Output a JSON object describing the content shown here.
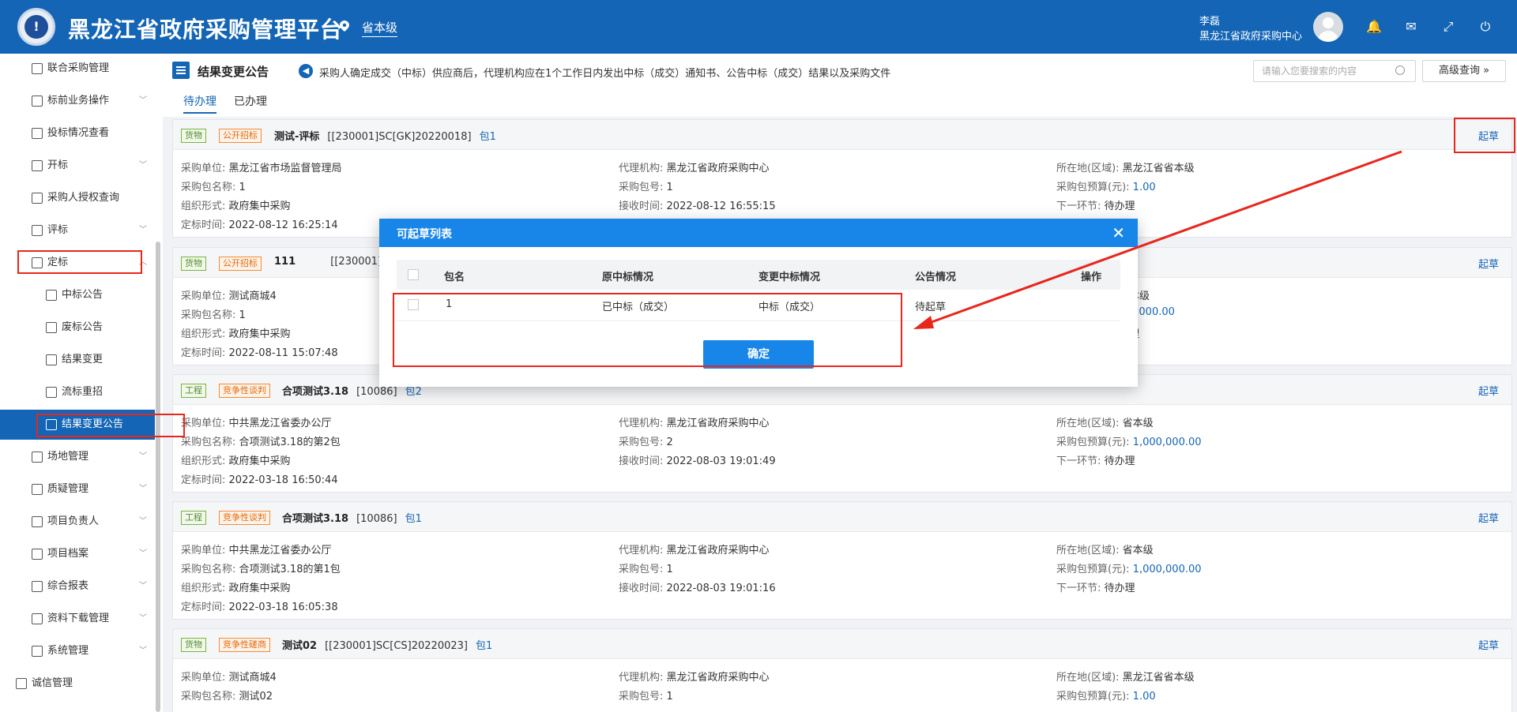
{
  "header": {
    "app_title": "黑龙江省政府采购管理平台",
    "region": "省本级",
    "user_name": "李磊",
    "user_org": "黑龙江省政府采购中心"
  },
  "sidebar": {
    "items": [
      {
        "label": "联合采购管理",
        "chevron": false
      },
      {
        "label": "标前业务操作",
        "chevron": true
      },
      {
        "label": "投标情况查看",
        "chevron": false
      },
      {
        "label": "开标",
        "chevron": true
      },
      {
        "label": "采购人授权查询",
        "chevron": false
      },
      {
        "label": "评标",
        "chevron": true
      },
      {
        "label": "定标",
        "chevron": true
      },
      {
        "label": "中标公告",
        "chevron": false
      },
      {
        "label": "废标公告",
        "chevron": false
      },
      {
        "label": "结果变更",
        "chevron": false
      },
      {
        "label": "流标重招",
        "chevron": false
      },
      {
        "label": "结果变更公告",
        "chevron": false
      },
      {
        "label": "场地管理",
        "chevron": true
      },
      {
        "label": "质疑管理",
        "chevron": true
      },
      {
        "label": "项目负责人",
        "chevron": true
      },
      {
        "label": "项目档案",
        "chevron": true
      },
      {
        "label": "综合报表",
        "chevron": true
      },
      {
        "label": "资料下载管理",
        "chevron": true
      },
      {
        "label": "系统管理",
        "chevron": true
      },
      {
        "label": "诚信管理",
        "chevron": false
      }
    ]
  },
  "page": {
    "title": "结果变更公告",
    "notice": "采购人确定成交（中标）供应商后，代理机构应在1个工作日内发出中标（成交）通知书、公告中标（成交）结果以及采购文件",
    "search_placeholder": "请输入您要搜索的内容",
    "advanced_search": "高级查询",
    "tabs": [
      "待办理",
      "已办理"
    ],
    "draft_label": "起草"
  },
  "cards": [
    {
      "type": "货物",
      "method": "公开招标",
      "name": "测试-评标",
      "code": "[[230001]SC[GK]20220018]",
      "pkg": "包1",
      "unit": "黑龙江省市场监督管理局",
      "pkg_name": "1",
      "org_form": "政府集中采购",
      "decide_time": "2022-08-12 16:25:14",
      "agency": "黑龙江省政府采购中心",
      "pkg_no": "1",
      "recv_time": "2022-08-12 16:55:15",
      "area": "黑龙江省省本级",
      "budget": "1.00",
      "next": "待办理"
    },
    {
      "type": "货物",
      "method": "公开招标",
      "name": "111",
      "code": "[[230001]SC",
      "pkg": "",
      "unit": "测试商城4",
      "pkg_name": "1",
      "org_form": "政府集中采购",
      "decide_time": "2022-08-11 15:07:48",
      "agency": "",
      "pkg_no": "",
      "recv_time": "",
      "area": "本级",
      "budget": "5,000.00",
      "next": "理"
    },
    {
      "type": "工程",
      "method": "竞争性谈判",
      "name": "合项测试3.18",
      "code": "[10086]",
      "pkg": "包2",
      "unit": "中共黑龙江省委办公厅",
      "pkg_name": "合项测试3.18的第2包",
      "org_form": "政府集中采购",
      "decide_time": "2022-03-18 16:50:44",
      "agency": "黑龙江省政府采购中心",
      "pkg_no": "2",
      "recv_time": "2022-08-03 19:01:49",
      "area": "省本级",
      "budget": "1,000,000.00",
      "next": "待办理"
    },
    {
      "type": "工程",
      "method": "竞争性谈判",
      "name": "合项测试3.18",
      "code": "[10086]",
      "pkg": "包1",
      "unit": "中共黑龙江省委办公厅",
      "pkg_name": "合项测试3.18的第1包",
      "org_form": "政府集中采购",
      "decide_time": "2022-03-18 16:05:38",
      "agency": "黑龙江省政府采购中心",
      "pkg_no": "1",
      "recv_time": "2022-08-03 19:01:16",
      "area": "省本级",
      "budget": "1,000,000.00",
      "next": "待办理"
    },
    {
      "type": "货物",
      "method": "竞争性磋商",
      "name": "测试02",
      "code": "[[230001]SC[CS]20220023]",
      "pkg": "包1",
      "unit": "测试商城4",
      "pkg_name": "测试02",
      "org_form": "",
      "agency": "黑龙江省政府采购中心",
      "pkg_no": "1",
      "area": "黑龙江省省本级",
      "budget": "1.00"
    }
  ],
  "labels": {
    "unit": "采购单位:",
    "pkg_name": "采购包名称:",
    "org_form": "组织形式:",
    "decide_time": "定标时间:",
    "agency": "代理机构:",
    "pkg_no": "采购包号:",
    "recv_time": "接收时间:",
    "area": "所在地(区域):",
    "budget": "采购包预算(元):",
    "next": "下一环节:"
  },
  "modal": {
    "title": "可起草列表",
    "columns": [
      "包名",
      "原中标情况",
      "变更中标情况",
      "公告情况",
      "操作"
    ],
    "rows": [
      {
        "pkg": "1",
        "orig": "已中标（成交）",
        "changed": "中标（成交）",
        "notice": "待起草",
        "op": ""
      }
    ],
    "confirm": "确定"
  },
  "colors": {
    "brand": "#1465b6",
    "modal_head": "#1886e8",
    "annotation": "#e8261c"
  }
}
